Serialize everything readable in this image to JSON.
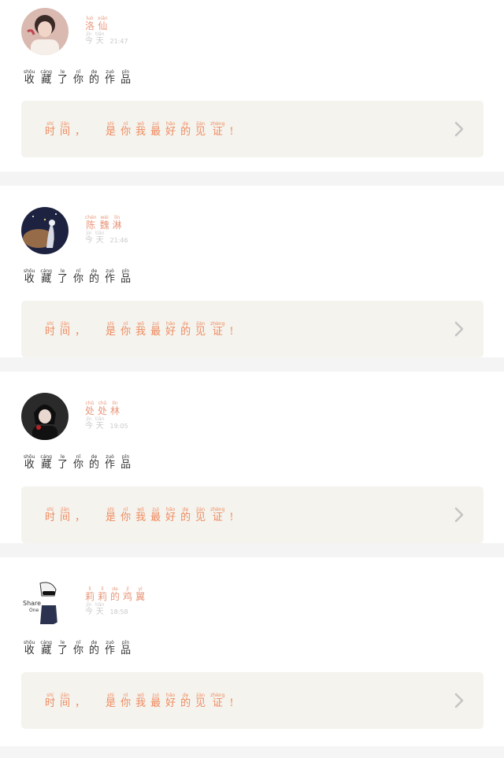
{
  "action_text": [
    {
      "py": "shōu",
      "hz": "收"
    },
    {
      "py": "cáng",
      "hz": "藏"
    },
    {
      "py": "le",
      "hz": "了"
    },
    {
      "py": "nǐ",
      "hz": "你"
    },
    {
      "py": "de",
      "hz": "的"
    },
    {
      "py": "zuò",
      "hz": "作"
    },
    {
      "py": "pǐn",
      "hz": "品"
    }
  ],
  "quote_text": [
    {
      "py": "shí",
      "hz": "时"
    },
    {
      "py": "jiān",
      "hz": "间"
    },
    {
      "py": "",
      "hz": "，"
    },
    {
      "py": "shì",
      "hz": "是"
    },
    {
      "py": "nǐ",
      "hz": "你"
    },
    {
      "py": "wǒ",
      "hz": "我"
    },
    {
      "py": "zuì",
      "hz": "最"
    },
    {
      "py": "hǎo",
      "hz": "好"
    },
    {
      "py": "de",
      "hz": "的"
    },
    {
      "py": "jiàn",
      "hz": "见"
    },
    {
      "py": "zhèng",
      "hz": "证"
    },
    {
      "py": "",
      "hz": "!"
    }
  ],
  "today": [
    {
      "py": "jīn",
      "hz": "今"
    },
    {
      "py": "tiān",
      "hz": "天"
    }
  ],
  "posts": [
    {
      "name": [
        {
          "py": "luò",
          "hz": "洛"
        },
        {
          "py": "xiān",
          "hz": "仙"
        }
      ],
      "time": "21:47"
    },
    {
      "name": [
        {
          "py": "chén",
          "hz": "陈"
        },
        {
          "py": "wèi",
          "hz": "魏"
        },
        {
          "py": "lín",
          "hz": "淋"
        }
      ],
      "time": "21:46"
    },
    {
      "name": [
        {
          "py": "chǔ",
          "hz": "处"
        },
        {
          "py": "chǔ",
          "hz": "处"
        },
        {
          "py": "lín",
          "hz": "林"
        }
      ],
      "time": "19:05"
    },
    {
      "name": [
        {
          "py": "lì",
          "hz": "莉"
        },
        {
          "py": "lì",
          "hz": "莉"
        },
        {
          "py": "de",
          "hz": "的"
        },
        {
          "py": "jī",
          "hz": "鸡"
        },
        {
          "py": "yì",
          "hz": "翼"
        }
      ],
      "time": "18:58"
    }
  ],
  "avatar4_text": [
    "Share",
    "One"
  ],
  "colors": {
    "accent": "#f08a5d",
    "name": "#e8967a",
    "panel": "#f4f3ee"
  }
}
